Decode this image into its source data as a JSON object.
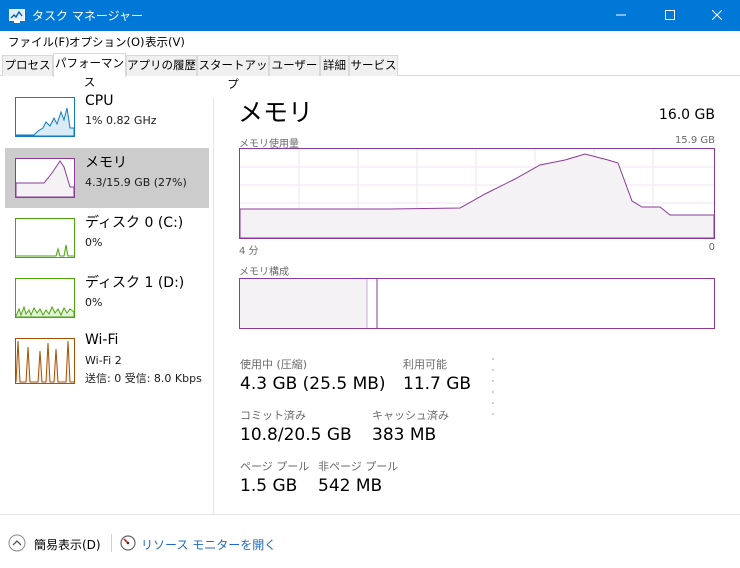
{
  "window": {
    "title": "タスク マネージャー"
  },
  "menu": [
    "ファイル(F)",
    "オプション(O)",
    "表示(V)"
  ],
  "tabs": [
    "プロセス",
    "パフォーマンス",
    "アプリの履歴",
    "スタートアップ",
    "ユーザー",
    "詳細",
    "サービス"
  ],
  "sidebar": {
    "items": [
      {
        "name": "CPU",
        "sub1": "1%  0.82 GHz",
        "sub2": ""
      },
      {
        "name": "メモリ",
        "sub1": "4.3/15.9 GB (27%)",
        "sub2": ""
      },
      {
        "name": "ディスク 0 (C:)",
        "sub1": "0%",
        "sub2": ""
      },
      {
        "name": "ディスク 1 (D:)",
        "sub1": "0%",
        "sub2": ""
      },
      {
        "name": "Wi-Fi",
        "sub1": "Wi-Fi 2",
        "sub2": "送信: 0 受信: 8.0 Kbps"
      }
    ]
  },
  "main": {
    "title": "メモリ",
    "total": "16.0 GB",
    "usage_label": "メモリ使用量",
    "usage_max": "15.9 GB",
    "axis_left": "4 分",
    "axis_right": "0",
    "composition_label": "メモリ構成"
  },
  "stats": {
    "in_use_label": "使用中 (圧縮)",
    "in_use_value": "4.3 GB (25.5 MB)",
    "available_label": "利用可能",
    "available_value": "11.7 GB",
    "committed_label": "コミット済み",
    "committed_value": "10.8/20.5 GB",
    "cached_label": "キャッシュ済み",
    "cached_value": "383 MB",
    "paged_label": "ページ プール",
    "paged_value": "1.5 GB",
    "nonpaged_label": "非ページ プール",
    "nonpaged_value": "542 MB"
  },
  "footer": {
    "fewer_details": "簡易表示(D)",
    "resource_monitor": "リソース モニターを開く"
  },
  "colors": {
    "titlebar": "#0078d7",
    "memory": "#8b3a9a",
    "cpu": "#117dbb",
    "disk": "#4da60c",
    "wifi": "#a74f01",
    "link": "#1c6bc4"
  }
}
